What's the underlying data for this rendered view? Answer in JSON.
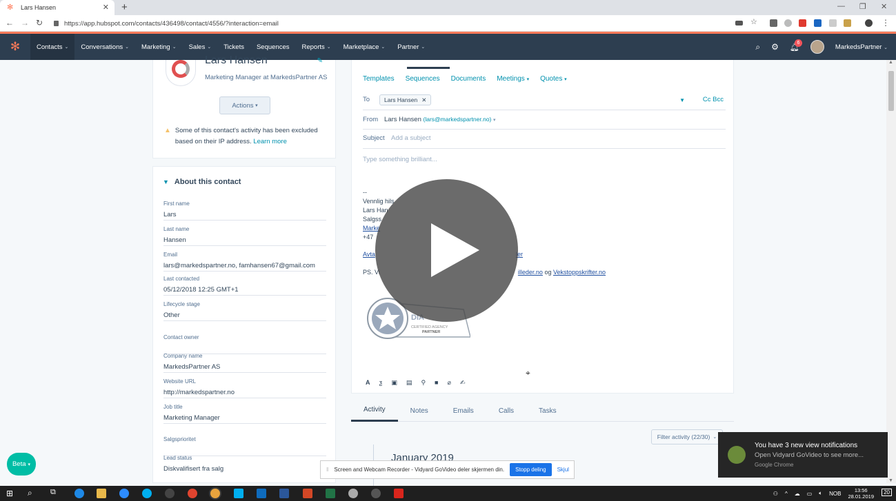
{
  "browser": {
    "tab_title": "Lars Hansen",
    "url": "https://app.hubspot.com/contacts/436498/contact/4556/?interaction=email"
  },
  "hubspot_nav": {
    "items": [
      {
        "label": "Contacts",
        "chevron": true
      },
      {
        "label": "Conversations",
        "chevron": true
      },
      {
        "label": "Marketing",
        "chevron": true
      },
      {
        "label": "Sales",
        "chevron": true
      },
      {
        "label": "Tickets",
        "chevron": false
      },
      {
        "label": "Sequences",
        "chevron": false
      },
      {
        "label": "Reports",
        "chevron": true
      },
      {
        "label": "Marketplace",
        "chevron": true
      },
      {
        "label": "Partner",
        "chevron": true
      }
    ],
    "account_label": "MarkedsPartner",
    "notification_count": "6"
  },
  "contact": {
    "name": "Lars Hansen",
    "title": "Marketing Manager at MarkedsPartner AS",
    "actions_label": "Actions",
    "warning_text": "Some of this contact's activity has been excluded based on their IP address.",
    "learn_more": "Learn more"
  },
  "about": {
    "heading": "About this contact",
    "properties": [
      {
        "label": "First name",
        "value": "Lars"
      },
      {
        "label": "Last name",
        "value": "Hansen"
      },
      {
        "label": "Email",
        "value": "lars@markedspartner.no, famhansen67@gmail.com"
      },
      {
        "label": "Last contacted",
        "value": "05/12/2018 12:25 GMT+1"
      },
      {
        "label": "Lifecycle stage",
        "value": "Other"
      },
      {
        "label": "Contact owner",
        "value": ""
      },
      {
        "label": "Company name",
        "value": "MarkedsPartner AS"
      },
      {
        "label": "Website URL",
        "value": "http://markedspartner.no"
      },
      {
        "label": "Job title",
        "value": "Marketing Manager"
      },
      {
        "label": "Salgsprioritet",
        "value": ""
      },
      {
        "label": "Lead status",
        "value": "Diskvalifisert fra salg"
      }
    ]
  },
  "composer": {
    "toolbar": [
      "Templates",
      "Sequences",
      "Documents",
      "Meetings",
      "Quotes"
    ],
    "to_label": "To",
    "to_chip": "Lars Hansen",
    "cc_bcc": "Cc  Bcc",
    "from_label": "From",
    "from_name": "Lars Hansen",
    "from_email": "(lars@markedspartner.no)",
    "subject_label": "Subject",
    "subject_placeholder": "Add a subject",
    "body_placeholder": "Type something brilliant...",
    "signature_lines": [
      "--",
      "Vennlig hils",
      "Lars Han",
      "Salgss",
      "Marke",
      "+47"
    ],
    "sig_link_left": "Avta",
    "sig_link_right": "ler",
    "ps_prefix": "PS. Vi",
    "ps_link1": "illeder.no",
    "ps_and": "og",
    "ps_link2": "Vekstoppskrifter.no",
    "badge_text1": "DIA",
    "badge_text2": "CERTIFIED AGENCY",
    "badge_text3": "PARTNER"
  },
  "activity": {
    "tabs": [
      "Activity",
      "Notes",
      "Emails",
      "Calls",
      "Tasks"
    ],
    "filter_label": "Filter activity (22/30)",
    "month": "January 2019"
  },
  "beta_label": "Beta",
  "sharebar": {
    "text": "Screen and Webcam Recorder - Vidyard GoVideo deler skjermen din.",
    "stop_label": "Stopp deling",
    "hide_label": "Skjul"
  },
  "toast": {
    "title": "You have 3 new view notifications",
    "subtitle": "Open Vidyard GoVideo to see more...",
    "source": "Google Chrome"
  },
  "taskbar": {
    "lang": "NOB",
    "time": "13:56",
    "date": "28.01.2019",
    "notif_count": "20"
  },
  "colors": {
    "hubspot_orange": "#ff7a59",
    "nav_bg": "#2d3e50",
    "link_teal": "#0091ae"
  }
}
